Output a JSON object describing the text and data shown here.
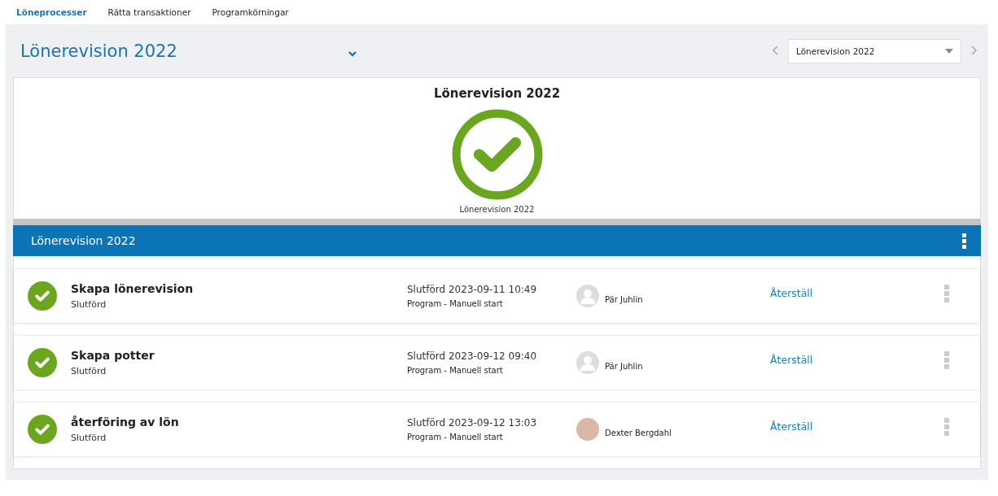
{
  "tabs": [
    {
      "label": "Löneprocesser",
      "selected": true
    },
    {
      "label": "Rätta transaktioner",
      "selected": false
    },
    {
      "label": "Programkörningar",
      "selected": false
    }
  ],
  "header": {
    "title": "Lönerevision 2022",
    "selector": {
      "value": "Lönerevision 2022"
    }
  },
  "summary": {
    "title": "Lönerevision 2022",
    "caption": "Lönerevision 2022"
  },
  "section": {
    "title": "Lönerevision 2022"
  },
  "steps": [
    {
      "title": "Skapa lönerevision",
      "kind": "done",
      "status_text": "Slutförd",
      "date": "Slutförd 2023-09-11 10:49",
      "source": "Program - Manuell start",
      "user": {
        "name": "Pär Juhlin",
        "kind": "placeholder"
      },
      "action": "Återställ"
    },
    {
      "title": "Skapa potter",
      "kind": "done",
      "status_text": "Slutförd",
      "date": "Slutförd 2023-09-12 09:40",
      "source": "Program - Manuell start",
      "user": {
        "name": "Pär Juhlin",
        "kind": "placeholder"
      },
      "action": "Återställ"
    },
    {
      "title": "återföring av lön",
      "kind": "done",
      "status_text": "Slutförd",
      "date": "Slutförd 2023-09-12 13:03",
      "source": "Program - Manuell start",
      "user": {
        "name": "Dexter Bergdahl",
        "kind": "photo"
      },
      "action": "Återställ"
    }
  ]
}
